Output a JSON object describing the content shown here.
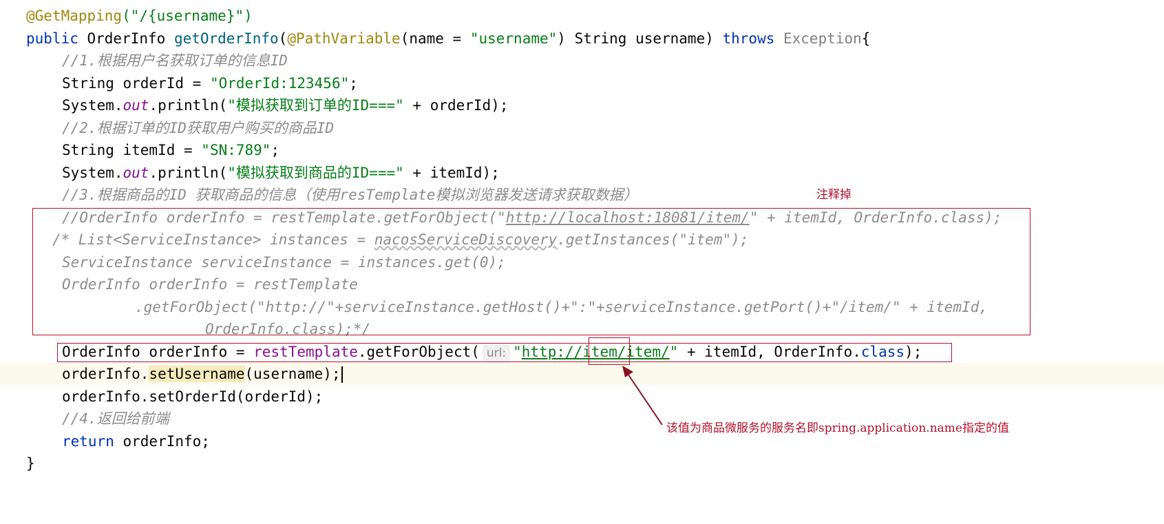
{
  "code": {
    "l1_annotation": "@GetMapping",
    "l1_path": "(\"/{username}\")",
    "l2_public": "public",
    "l2_type": " OrderInfo ",
    "l2_method": "getOrderInfo",
    "l2_paren": "(",
    "l2_pathvar": "@PathVariable",
    "l2_name_open": "(name = ",
    "l2_name_str": "\"username\"",
    "l2_params": ") String username) ",
    "l2_throws": "throws",
    "l2_exception": " Exception",
    "l2_brace": "{",
    "c1": "//1.根据用户名获取订单的信息ID",
    "l4_decl": "String orderId = ",
    "l4_str": "\"OrderId:123456\"",
    "l4_end": ";",
    "l5_system": "System.",
    "l5_out": "out",
    "l5_println": ".println(",
    "l5_str": "\"模拟获取到订单的ID===\"",
    "l5_rest": " + orderId);",
    "c2": "//2.根据订单的ID获取用户购买的商品ID",
    "l7_decl": "String itemId = ",
    "l7_str": "\"SN:789\"",
    "l7_end": ";",
    "l8_system": "System.",
    "l8_out": "out",
    "l8_println": ".println(",
    "l8_str": "\"模拟获取到商品的ID===\"",
    "l8_rest": " + itemId);",
    "c3": "//3.根据商品的ID 获取商品的信息（使用resTemplate模拟浏览器发送请求获取数据）",
    "c4_pre": "//OrderInfo orderInfo = restTemplate.getForObject(\"",
    "c4_url": "http://localhost:18081/item/",
    "c4_post": "\" + itemId, OrderInfo.class);",
    "c5_pre": "/* List<ServiceInstance> instances = ",
    "c5_wavy": "nacosServiceDiscovery",
    "c5_post": ".getInstances(\"item\");",
    "c6": "ServiceInstance serviceInstance = instances.get(0);",
    "c7": "OrderInfo orderInfo = restTemplate",
    "c8": ".getForObject(\"http://\"+serviceInstance.getHost()+\":\"+serviceInstance.getPort()+\"/item/\" + itemId,",
    "c9": "OrderInfo.class);*/",
    "l16_decl": "OrderInfo orderInfo = ",
    "l16_rest_template": "restTemplate",
    "l16_get": ".getForObject(",
    "l16_hint": "url:",
    "l16_q1": "\"",
    "l16_url": "http://item/item/",
    "l16_q2": "\"",
    "l16_mid": " + itemId, OrderInfo.",
    "l16_class": "class",
    "l16_end": ");",
    "l17_pre": "orderInfo.",
    "l17_method": "setUsername",
    "l17_post": "(username);",
    "l18": "orderInfo.setOrderId(orderId);",
    "c10": "//4.返回给前端",
    "l20_return": "return",
    "l20_rest": " orderInfo;",
    "l21_brace": "}"
  },
  "annotations": {
    "comment_out_note": "注释掉",
    "service_name_note": "该值为商品微服务的服务名即spring.application.name指定的值"
  },
  "colors": {
    "annotation_red": "#b0102a",
    "keyword": "#0033b3",
    "string": "#067d17",
    "comment": "#8c8c8c",
    "field": "#871094",
    "annotation": "#9e880d",
    "current_line": "#fcfaed"
  }
}
